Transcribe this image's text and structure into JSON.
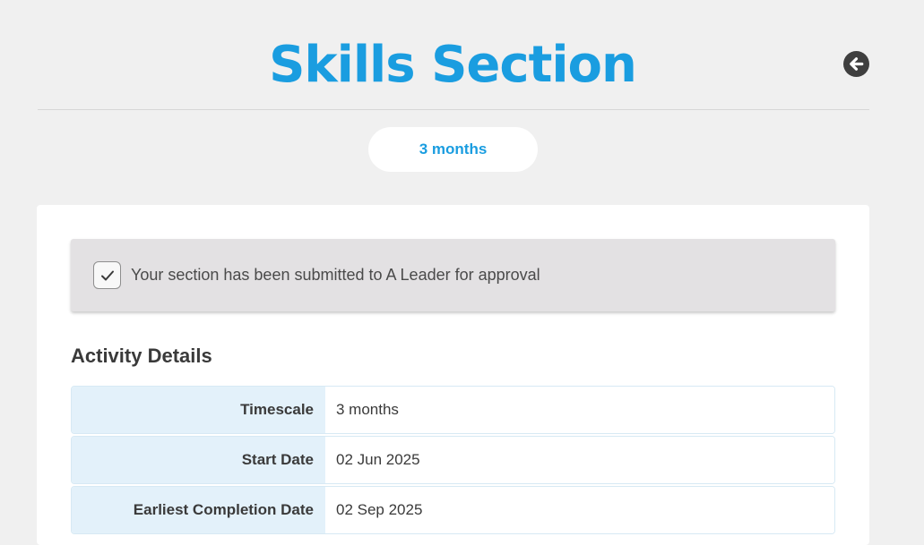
{
  "header": {
    "title": "Skills Section",
    "back_icon": "arrow-left-circle-icon"
  },
  "timescale_pill": {
    "label": "3 months"
  },
  "status_banner": {
    "checked": true,
    "icon": "checkmark-icon",
    "text": "Your section has been submitted to A Leader for approval"
  },
  "activity_details": {
    "heading": "Activity Details",
    "rows": [
      {
        "label": "Timescale",
        "value": "3 months"
      },
      {
        "label": "Start Date",
        "value": "02 Jun 2025"
      },
      {
        "label": "Earliest Completion Date",
        "value": "02 Sep 2025"
      }
    ]
  },
  "colors": {
    "accent": "#1a9de0",
    "background": "#f0f0f0",
    "banner": "#e3e1e3",
    "label_cell": "#e3f1fa"
  }
}
